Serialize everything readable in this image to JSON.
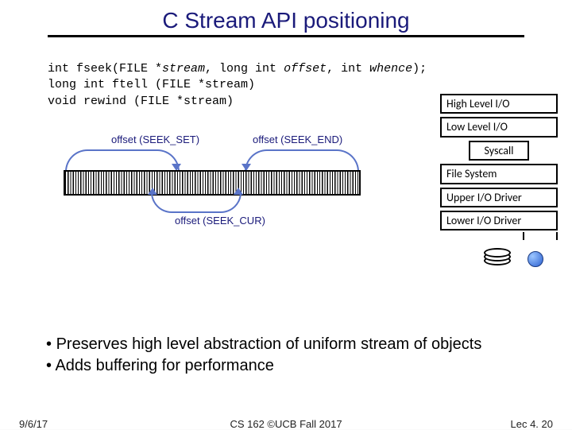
{
  "title": "C Stream API positioning",
  "code": {
    "line1_a": "int fseek(FILE *",
    "line1_b": "stream",
    "line1_c": ", long int ",
    "line1_d": "offset",
    "line1_e": ", int ",
    "line1_f": "whence",
    "line1_g": ");",
    "line2": "long int ftell (FILE *stream)",
    "line3": "void rewind (FILE *stream)"
  },
  "seek": {
    "set": "offset (SEEK_SET)",
    "end": "offset (SEEK_END)",
    "cur": "offset (SEEK_CUR)"
  },
  "stack": {
    "l0": "High Level I/O",
    "l1": "Low Level I/O",
    "l2": "Syscall",
    "l3": "File System",
    "l4": "Upper I/O Driver",
    "l5": "Lower I/O Driver"
  },
  "bullets": {
    "b1": "Preserves high level abstraction of uniform stream of objects",
    "b2": "Adds buffering for performance"
  },
  "footer": {
    "left": "9/6/17",
    "center": "CS 162 ©UCB Fall 2017",
    "right": "Lec 4. 20"
  }
}
